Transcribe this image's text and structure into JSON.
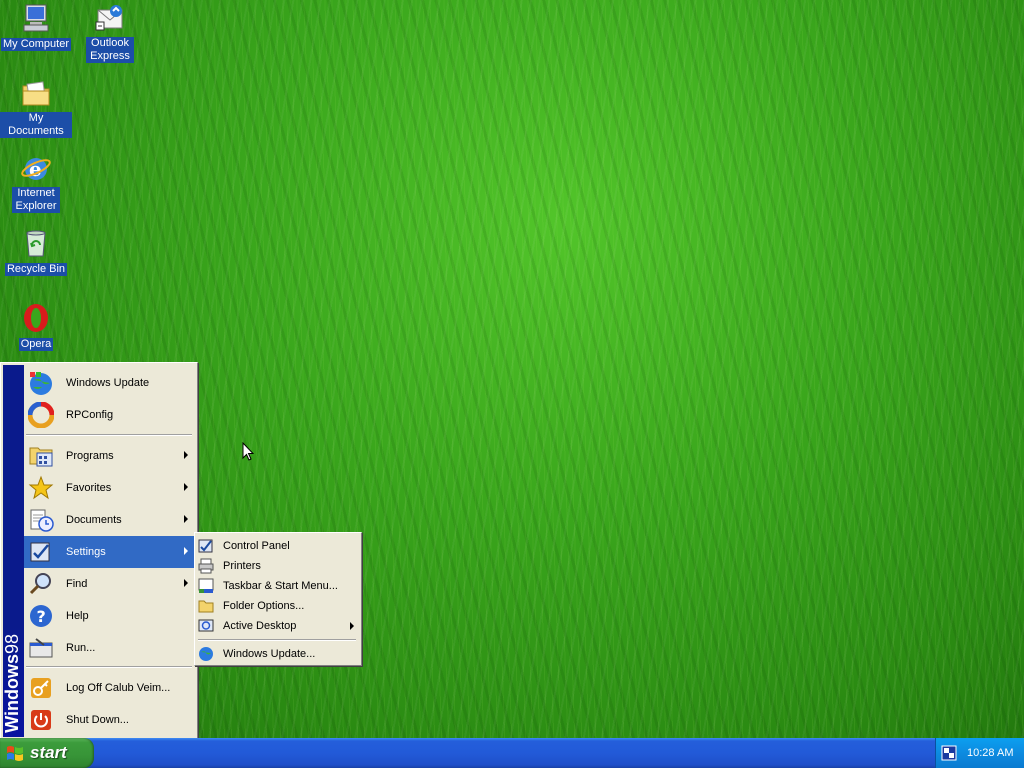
{
  "desktop": {
    "icons": [
      {
        "label": "My Computer",
        "icon": "computer-icon"
      },
      {
        "label": "Outlook Express",
        "icon": "mail-icon"
      },
      {
        "label": "My Documents",
        "icon": "folder-icon"
      },
      {
        "label": "Internet Explorer",
        "icon": "ie-icon"
      },
      {
        "label": "Recycle Bin",
        "icon": "recycle-bin-icon"
      },
      {
        "label": "Opera",
        "icon": "opera-icon"
      }
    ]
  },
  "start_menu": {
    "banner": {
      "bold": "Windows",
      "thin": "98"
    },
    "items": [
      {
        "label": "Windows Update",
        "icon": "windows-update-icon"
      },
      {
        "label": "RPConfig",
        "icon": "rpconfig-icon"
      },
      {
        "label": "Programs",
        "icon": "programs-icon"
      },
      {
        "label": "Favorites",
        "icon": "favorites-icon"
      },
      {
        "label": "Documents",
        "icon": "documents-icon"
      },
      {
        "label": "Settings",
        "icon": "settings-icon"
      },
      {
        "label": "Find",
        "icon": "find-icon"
      },
      {
        "label": "Help",
        "icon": "help-icon"
      },
      {
        "label": "Run...",
        "icon": "run-icon"
      },
      {
        "label": "Log Off Calub Veim...",
        "icon": "logoff-icon"
      },
      {
        "label": "Shut Down...",
        "icon": "shutdown-icon"
      }
    ]
  },
  "settings_submenu": {
    "items": [
      {
        "label": "Control Panel",
        "icon": "control-panel-icon"
      },
      {
        "label": "Printers",
        "icon": "printers-icon"
      },
      {
        "label": "Taskbar & Start Menu...",
        "icon": "taskbar-icon"
      },
      {
        "label": "Folder Options...",
        "icon": "folder-options-icon"
      },
      {
        "label": "Active Desktop",
        "icon": "active-desktop-icon"
      },
      {
        "label": "Windows Update...",
        "icon": "windows-update-icon"
      }
    ]
  },
  "taskbar": {
    "start_label": "start",
    "clock": "10:28 AM",
    "tray_icon": "language-icon"
  },
  "colors": {
    "selection": "#316ac5",
    "banner": "#0a1a8c",
    "menu_bg": "#ece9d8",
    "taskbar_blue": "#245edb",
    "start_green": "#379437"
  }
}
